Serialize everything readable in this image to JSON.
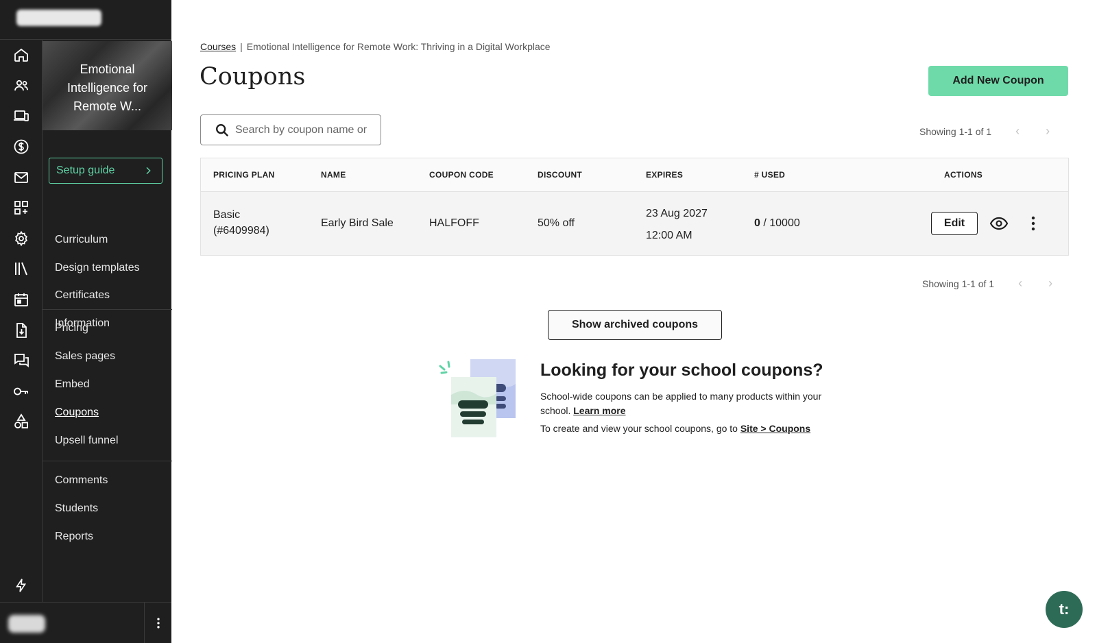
{
  "rail": {
    "icons": [
      "home-icon",
      "users-icon",
      "devices-icon",
      "dollar-icon",
      "mail-icon",
      "apps-icon",
      "settings-icon",
      "library-icon",
      "calendar-icon",
      "download-doc-icon",
      "chat-icon",
      "key-icon",
      "shapes-icon"
    ]
  },
  "course": {
    "thumb_title": "Emotional Intelligence for Remote W...",
    "setup_guide": "Setup guide",
    "group1": [
      "Curriculum",
      "Design templates",
      "Certificates",
      "Information"
    ],
    "group2": [
      "Pricing",
      "Sales pages",
      "Embed",
      "Coupons",
      "Upsell funnel"
    ],
    "group3": [
      "Comments",
      "Students",
      "Reports"
    ],
    "active": "Coupons"
  },
  "breadcrumb": {
    "link": "Courses",
    "separator": "|",
    "current": "Emotional Intelligence for Remote Work: Thriving in a Digital Workplace"
  },
  "page": {
    "title": "Coupons",
    "add_button": "Add New Coupon",
    "search_placeholder": "Search by coupon name or",
    "showing": "Showing 1-1 of 1"
  },
  "table": {
    "headers": {
      "plan": "PRICING PLAN",
      "name": "NAME",
      "code": "COUPON CODE",
      "discount": "DISCOUNT",
      "expires": "EXPIRES",
      "used": "# USED",
      "actions": "ACTIONS"
    },
    "rows": [
      {
        "plan_line1": "Basic",
        "plan_line2": "(#6409984)",
        "name": "Early Bird Sale",
        "code": "HALFOFF",
        "discount": "50% off",
        "expires_date": "23 Aug 2027",
        "expires_time": "12:00 AM",
        "used": "0",
        "used_total": " / 10000",
        "edit": "Edit"
      }
    ]
  },
  "archived_button": "Show archived coupons",
  "promo": {
    "title": "Looking for your school coupons?",
    "text": "School-wide coupons can be applied to many products within your school.",
    "learn_more": "Learn more",
    "text2": "To create and view your school coupons, go to",
    "site_link": "Site > Coupons"
  },
  "chat": {
    "label": "t:"
  },
  "colors": {
    "sidebar_bg": "#1f1f1f",
    "accent_green": "#6fdaa9",
    "setup_green": "#5fd3a6",
    "chat_bg": "#2e6b57"
  }
}
